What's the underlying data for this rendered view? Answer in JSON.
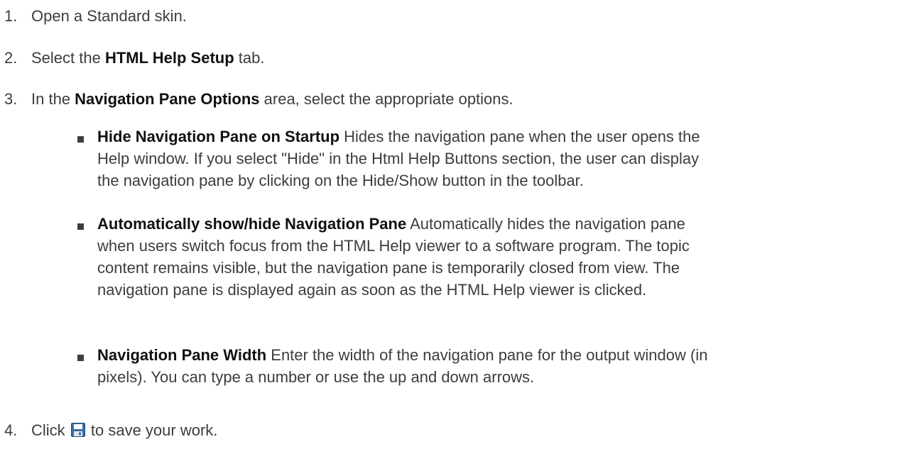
{
  "steps": [
    {
      "num": "1.",
      "text": "Open a Standard skin."
    },
    {
      "num": "2.",
      "pre": "Select the ",
      "bold": "HTML Help Setup",
      "post": " tab."
    },
    {
      "num": "3.",
      "pre": "In the ",
      "bold": "Navigation Pane Options",
      "post": " area, select the appropriate options."
    },
    {
      "num": "4.",
      "pre": "Click ",
      "icon": "save-icon",
      "post": " to save your work."
    }
  ],
  "bullets": [
    {
      "bold": "Hide Navigation Pane on Startup",
      "lines": [
        " Hides the navigation pane when the user opens the",
        "Help window. If you select \"Hide\" in the Html Help Buttons section, the user can display",
        "the navigation pane by clicking on the Hide/Show button in the toolbar."
      ]
    },
    {
      "bold": "Automatically show/hide Navigation Pane",
      "lines": [
        " Automatically hides the navigation pane",
        "when users switch focus from the HTML Help viewer to a software program. The topic",
        "content remains visible, but the navigation pane is temporarily closed from view. The",
        "navigation pane is displayed again as soon as the HTML Help viewer is clicked."
      ]
    },
    {
      "bold": "Navigation Pane Width",
      "lines": [
        " Enter the width of the navigation pane for the output window (in",
        "pixels). You can type a number or use the up and down arrows."
      ]
    }
  ]
}
